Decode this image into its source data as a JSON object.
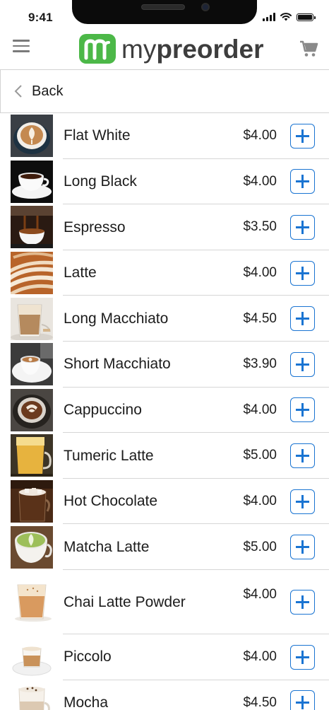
{
  "status_bar": {
    "time": "9:41"
  },
  "header": {
    "brand_prefix": "my",
    "brand_name": "preorder",
    "brand_color": "#4cb848",
    "icons": [
      "menu-icon",
      "cart-icon"
    ]
  },
  "nav": {
    "back_label": "Back"
  },
  "accent_color": "#1a74d2",
  "items": [
    {
      "name": "Flat White",
      "price": "$4.00"
    },
    {
      "name": "Long Black",
      "price": "$4.00"
    },
    {
      "name": "Espresso",
      "price": "$3.50"
    },
    {
      "name": "Latte",
      "price": "$4.00"
    },
    {
      "name": "Long Macchiato",
      "price": "$4.50"
    },
    {
      "name": "Short Macchiato",
      "price": "$3.90"
    },
    {
      "name": "Cappuccino",
      "price": "$4.00"
    },
    {
      "name": "Tumeric Latte",
      "price": "$5.00"
    },
    {
      "name": "Hot Chocolate",
      "price": "$4.00"
    },
    {
      "name": "Matcha Latte",
      "price": "$5.00"
    },
    {
      "name": "Chai Latte Powder",
      "price": "$4.00"
    },
    {
      "name": "Piccolo",
      "price": "$4.00"
    },
    {
      "name": "Mocha",
      "price": "$4.50"
    }
  ]
}
